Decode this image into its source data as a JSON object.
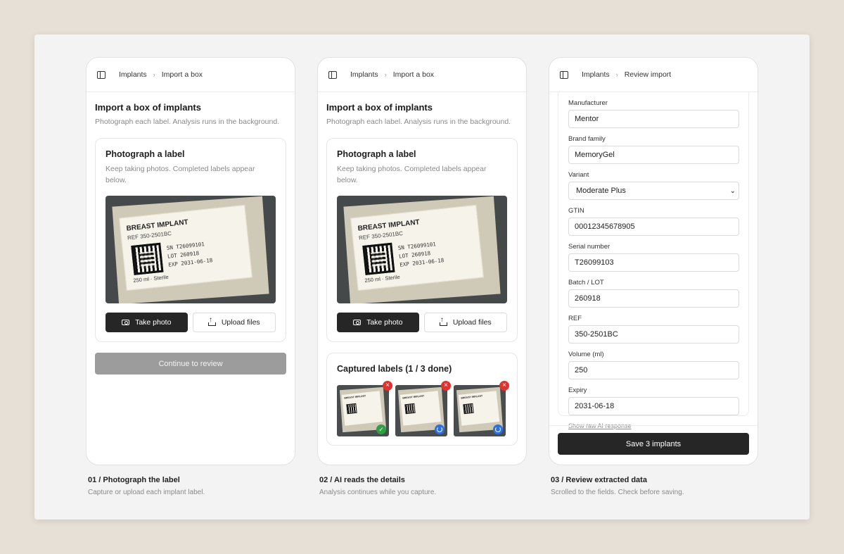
{
  "breadcrumb_root": "Implants",
  "screen1": {
    "crumb": "Import a box",
    "title": "Import a box of implants",
    "subtitle": "Photograph each label. Analysis runs in the background.",
    "card_title": "Photograph a label",
    "card_sub": "Keep taking photos. Completed labels appear below.",
    "take_photo": "Take photo",
    "upload_files": "Upload files",
    "continue": "Continue to review"
  },
  "label": {
    "title": "BREAST IMPLANT",
    "ref": "REF 350-2501BC",
    "sn": "SN T26099101",
    "lot": "LOT 260918",
    "exp": "EXP 2031-06-18",
    "foot": "250 ml · Sterile"
  },
  "screen2": {
    "crumb": "Import a box",
    "captured_title": "Captured labels (1 / 3 done)",
    "thumbs": [
      {
        "status": "done",
        "remove_icon": "×",
        "status_icon": "✓"
      },
      {
        "status": "processing",
        "remove_icon": "×"
      },
      {
        "status": "processing",
        "remove_icon": "×"
      }
    ]
  },
  "screen3": {
    "crumb": "Review import",
    "fields": [
      {
        "label": "Manufacturer",
        "value": "Mentor"
      },
      {
        "label": "Brand family",
        "value": "MemoryGel"
      },
      {
        "label": "Variant",
        "value": "Moderate Plus",
        "select": true
      },
      {
        "label": "GTIN",
        "value": "00012345678905"
      },
      {
        "label": "Serial number",
        "value": "T26099103"
      },
      {
        "label": "Batch / LOT",
        "value": "260918"
      },
      {
        "label": "REF",
        "value": "350-2501BC"
      },
      {
        "label": "Volume (ml)",
        "value": "250"
      },
      {
        "label": "Expiry",
        "value": "2031-06-18"
      }
    ],
    "raw_link": "Show raw AI response",
    "save": "Save 3 implants"
  },
  "captions": [
    {
      "title": "01 / Photograph the label",
      "sub": "Capture or upload each implant label."
    },
    {
      "title": "02 / AI reads the details",
      "sub": "Analysis continues while you capture."
    },
    {
      "title": "03 / Review extracted data",
      "sub": "Scrolled to the fields. Check before saving."
    }
  ],
  "colors": {
    "dark": "#262626",
    "disabled": "#9c9c9c",
    "error": "#e0322f",
    "success": "#2f9e44",
    "processing": "#2f6fde"
  }
}
